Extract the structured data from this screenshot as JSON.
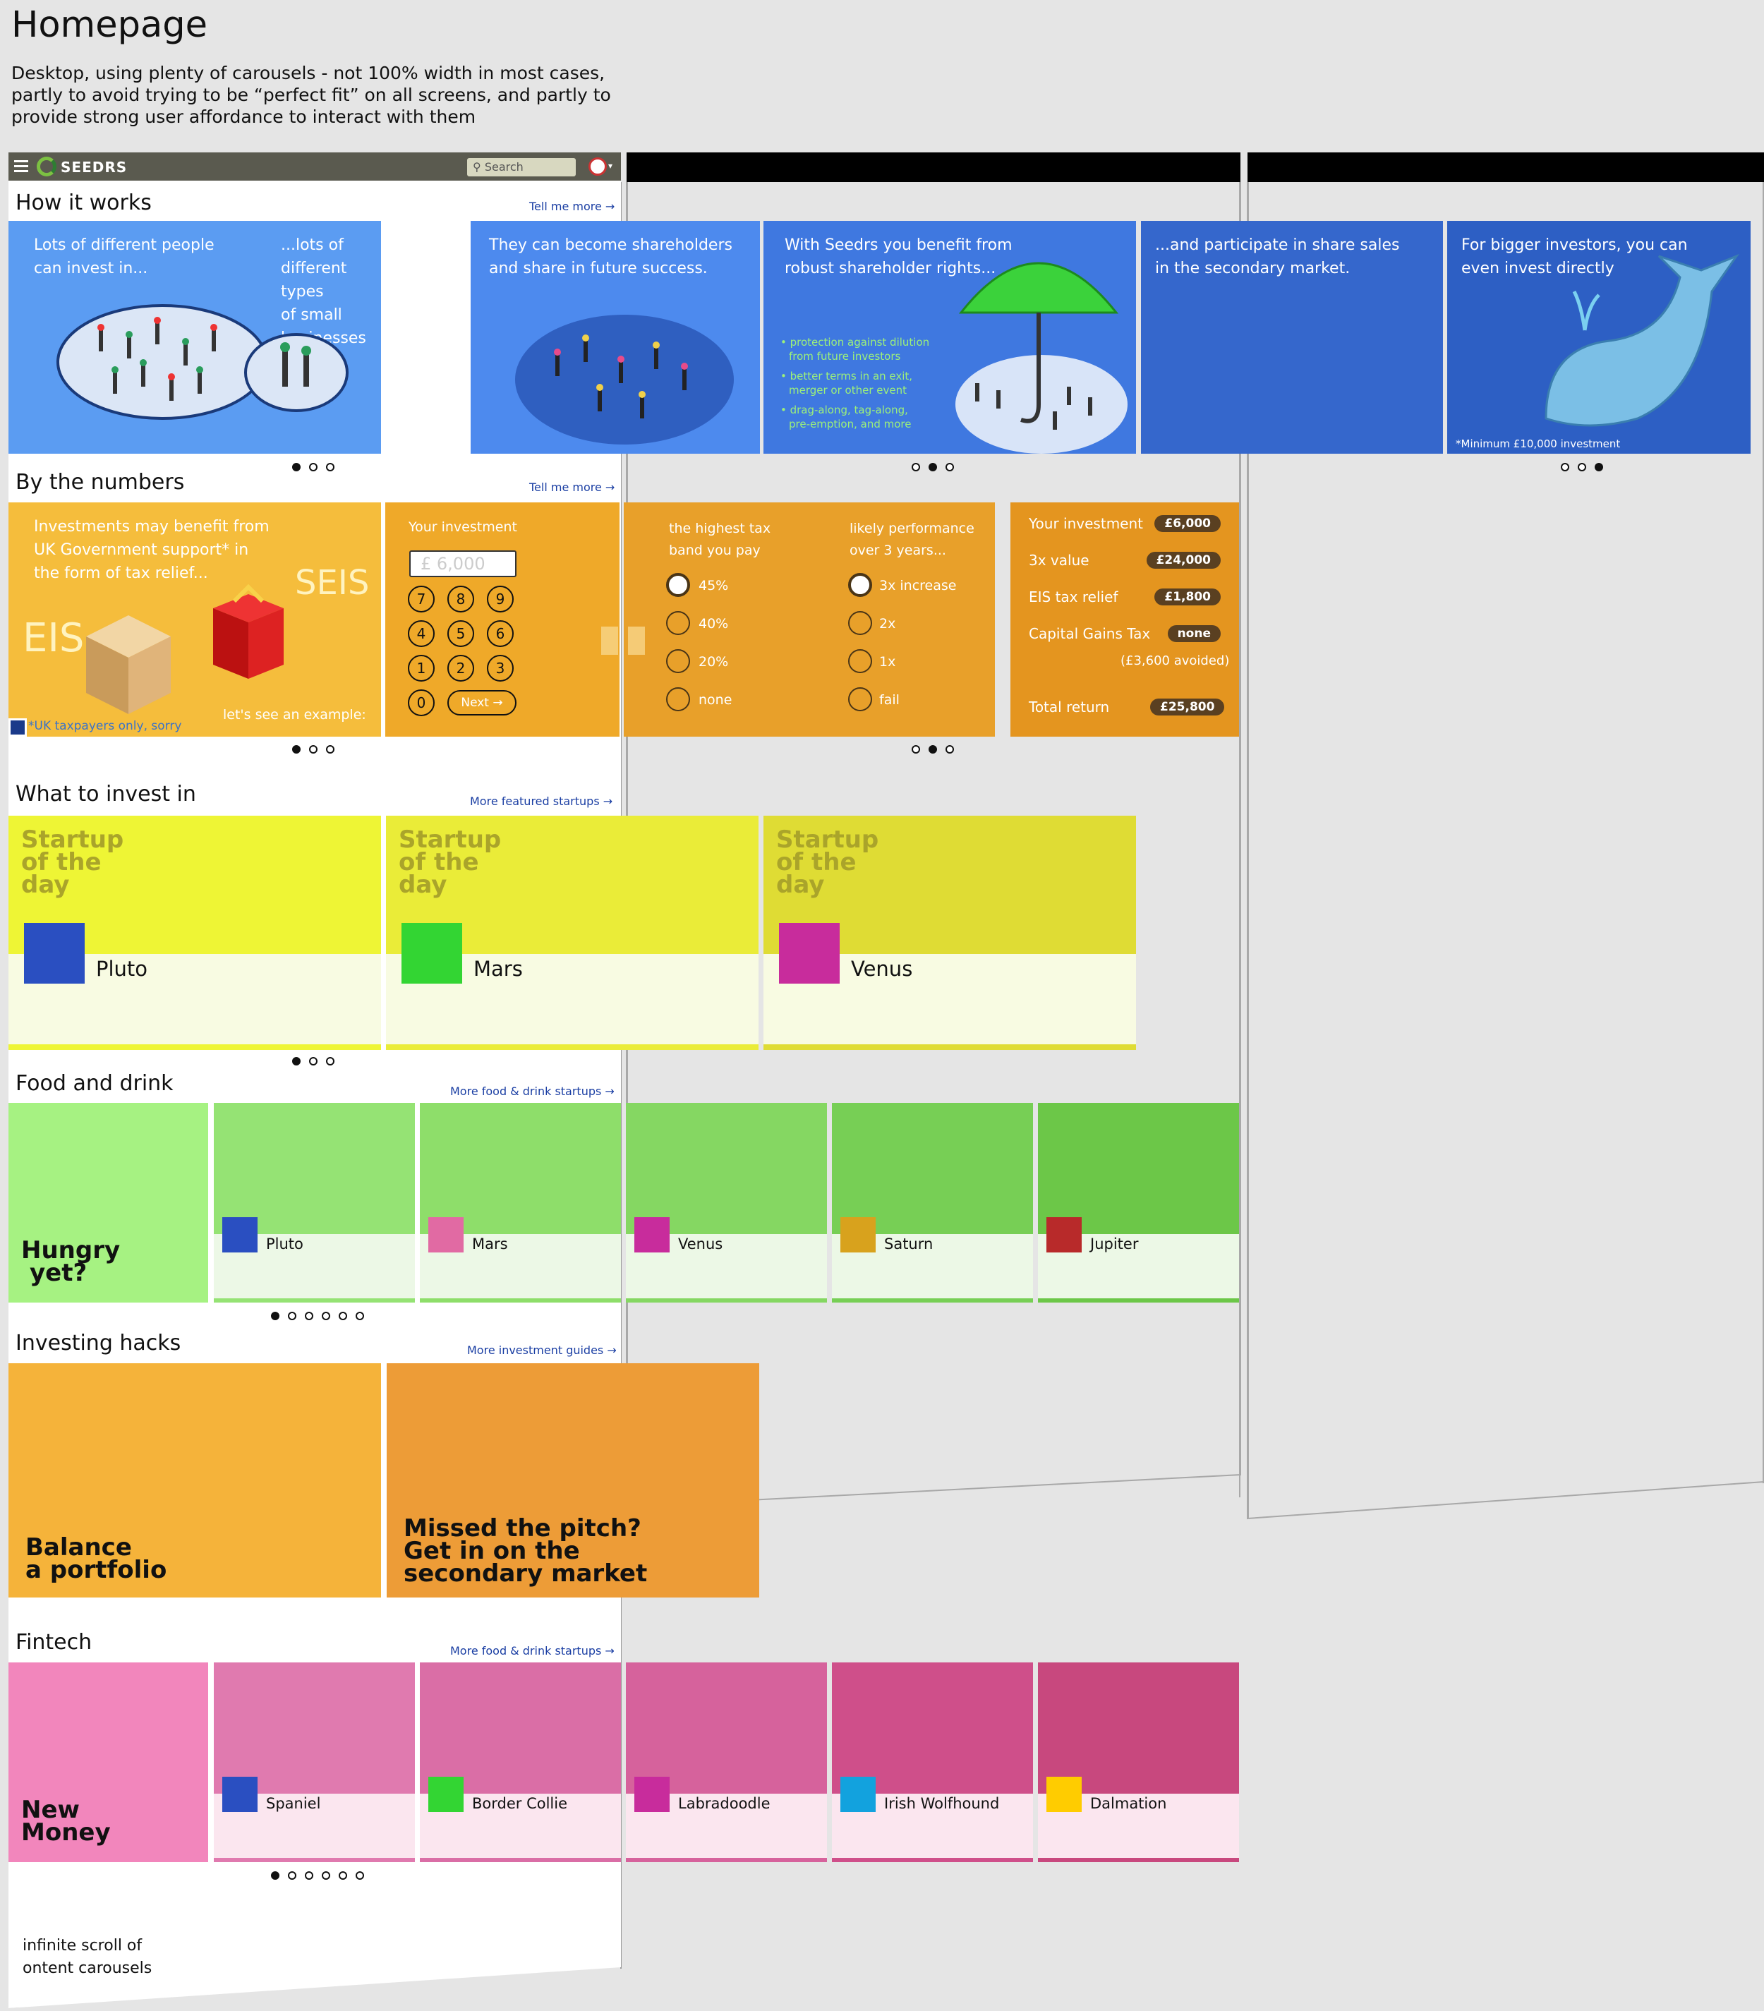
{
  "page": {
    "title": "Homepage",
    "description": "Desktop, using plenty of carousels - not 100% width in most cases, partly to avoid trying to be “perfect fit” on all screens, and partly to provide strong user affordance to interact with them",
    "footer_note_line1": "infinite scroll of",
    "footer_note_line2": "ontent carousels"
  },
  "nav": {
    "logo": "SEEDRS",
    "search_placeholder": "Search"
  },
  "how": {
    "title": "How it works",
    "more": "Tell me more →",
    "p1a": "Lots of different people",
    "p1b": "can invest in...",
    "p2a": "...lots of different types",
    "p2b": "of small businesses",
    "p3a": "They can become shareholders",
    "p3b": "and share in future success.",
    "p4a": "With Seedrs you benefit from",
    "p4b": "robust shareholder rights...",
    "p4bul1": "• protection against dilution",
    "p4bul1b": "from future investors",
    "p4bul2": "• better terms in an exit,",
    "p4bul2b": "merger or other event",
    "p4bul3": "• drag-along, tag-along,",
    "p4bul3b": "pre-emption, and more",
    "p5a": "...and participate in share sales",
    "p5b": "in the secondary market.",
    "p6a": "For bigger investors, you can",
    "p6b": "even invest directly",
    "p6note": "*Minimum £10,000 investment"
  },
  "numbers": {
    "title": "By the numbers",
    "more": "Tell me more →",
    "intro1": "Investments may benefit from",
    "intro2": "UK Government support* in",
    "intro3": "the form of tax relief...",
    "seis": "SEIS",
    "eis": "EIS",
    "example": "let's see an example:",
    "uk_note": "*UK taxpayers only, sorry",
    "your_investment": "Your investment",
    "input_value": "£ 6,000",
    "keys": [
      "7",
      "8",
      "9",
      "4",
      "5",
      "6",
      "1",
      "2",
      "3",
      "0"
    ],
    "next": "Next →",
    "tax_head1": "the highest tax",
    "tax_head2": "band you pay",
    "tax_options": [
      "45%",
      "40%",
      "20%",
      "none"
    ],
    "perf_head1": "likely performance",
    "perf_head2": "over 3 years...",
    "perf_options": [
      "3x increase",
      "2x",
      "1x",
      "fail"
    ],
    "r_labels": [
      "Your investment",
      "3x value",
      "EIS tax relief",
      "Capital Gains Tax"
    ],
    "r_values": [
      "£6,000",
      "£24,000",
      "£1,800",
      "none"
    ],
    "avoided": "(£3,600 avoided)",
    "total_label": "Total return",
    "total_value": "£25,800"
  },
  "invest": {
    "title": "What to invest in",
    "more": "More featured startups →",
    "tag1": "Startup",
    "tag2": "of the",
    "tag3": "day",
    "names": [
      "Pluto",
      "Mars",
      "Venus"
    ]
  },
  "food": {
    "title": "Food and drink",
    "more": "More food & drink startups →",
    "hero1": "Hungry",
    "hero2": "yet?",
    "names": [
      "Pluto",
      "Mars",
      "Venus",
      "Saturn",
      "Jupiter"
    ]
  },
  "hacks": {
    "title": "Investing hacks",
    "more": "More investment guides →",
    "t1a": "Balance",
    "t1b": "a portfolio",
    "t2a": "Missed the pitch?",
    "t2b": "Get in on the",
    "t2c": "secondary market"
  },
  "fintech": {
    "title": "Fintech",
    "more": "More food & drink startups →",
    "hero1": "New",
    "hero2": "Money",
    "names": [
      "Spaniel",
      "Border Collie",
      "Labradoodle",
      "Irish Wolfhound",
      "Dalmation"
    ]
  },
  "colors": {
    "blue1": "#5b9cf2",
    "blue2": "#4d8aee",
    "blue3": "#3f78e0",
    "blue4": "#3567cc",
    "blue5": "#2d5fc4",
    "blue6": "#2553b0",
    "orange1": "#f5bd3c",
    "orange2": "#efa929",
    "orange3": "#e8a02a",
    "orange4": "#e4951f"
  }
}
